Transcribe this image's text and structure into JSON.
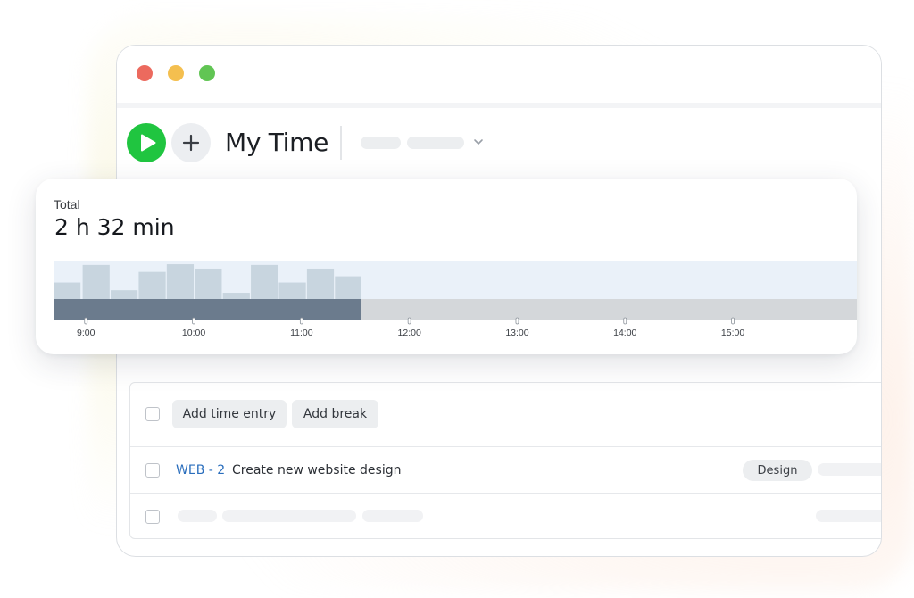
{
  "window": {
    "traffic_lights": [
      "close",
      "minimize",
      "zoom"
    ]
  },
  "header": {
    "title": "My Time"
  },
  "colors": {
    "accent_green": "#20c540",
    "link_blue": "#2a6ebd",
    "bar_light": "#c8d5df",
    "bar_dark": "#6b7b8d",
    "track_gray": "#d4d7da",
    "chart_bg": "#eaf1f9"
  },
  "summary": {
    "label": "Total",
    "value": "2 h 32 min"
  },
  "chart_data": {
    "type": "bar",
    "x_ticks": [
      "9:00",
      "10:00",
      "11:00",
      "12:00",
      "13:00",
      "14:00",
      "15:00"
    ],
    "x_range_hours": [
      8.7,
      16.15
    ],
    "tracked_until_hour": 11.55,
    "bars": [
      {
        "start": 8.7,
        "end": 8.95,
        "level": 0.45
      },
      {
        "start": 8.97,
        "end": 9.22,
        "level": 0.93
      },
      {
        "start": 9.23,
        "end": 9.48,
        "level": 0.24
      },
      {
        "start": 9.49,
        "end": 9.74,
        "level": 0.74
      },
      {
        "start": 9.75,
        "end": 10.0,
        "level": 0.95
      },
      {
        "start": 10.01,
        "end": 10.26,
        "level": 0.83
      },
      {
        "start": 10.27,
        "end": 10.52,
        "level": 0.17
      },
      {
        "start": 10.53,
        "end": 10.78,
        "level": 0.93
      },
      {
        "start": 10.79,
        "end": 11.04,
        "level": 0.45
      },
      {
        "start": 11.05,
        "end": 11.3,
        "level": 0.83
      },
      {
        "start": 11.31,
        "end": 11.55,
        "level": 0.62
      }
    ]
  },
  "toolbar": {
    "add_time_entry": "Add time entry",
    "add_break": "Add break"
  },
  "entries": [
    {
      "key": "WEB - 2",
      "name": "Create new website design",
      "tag": "Design"
    }
  ]
}
